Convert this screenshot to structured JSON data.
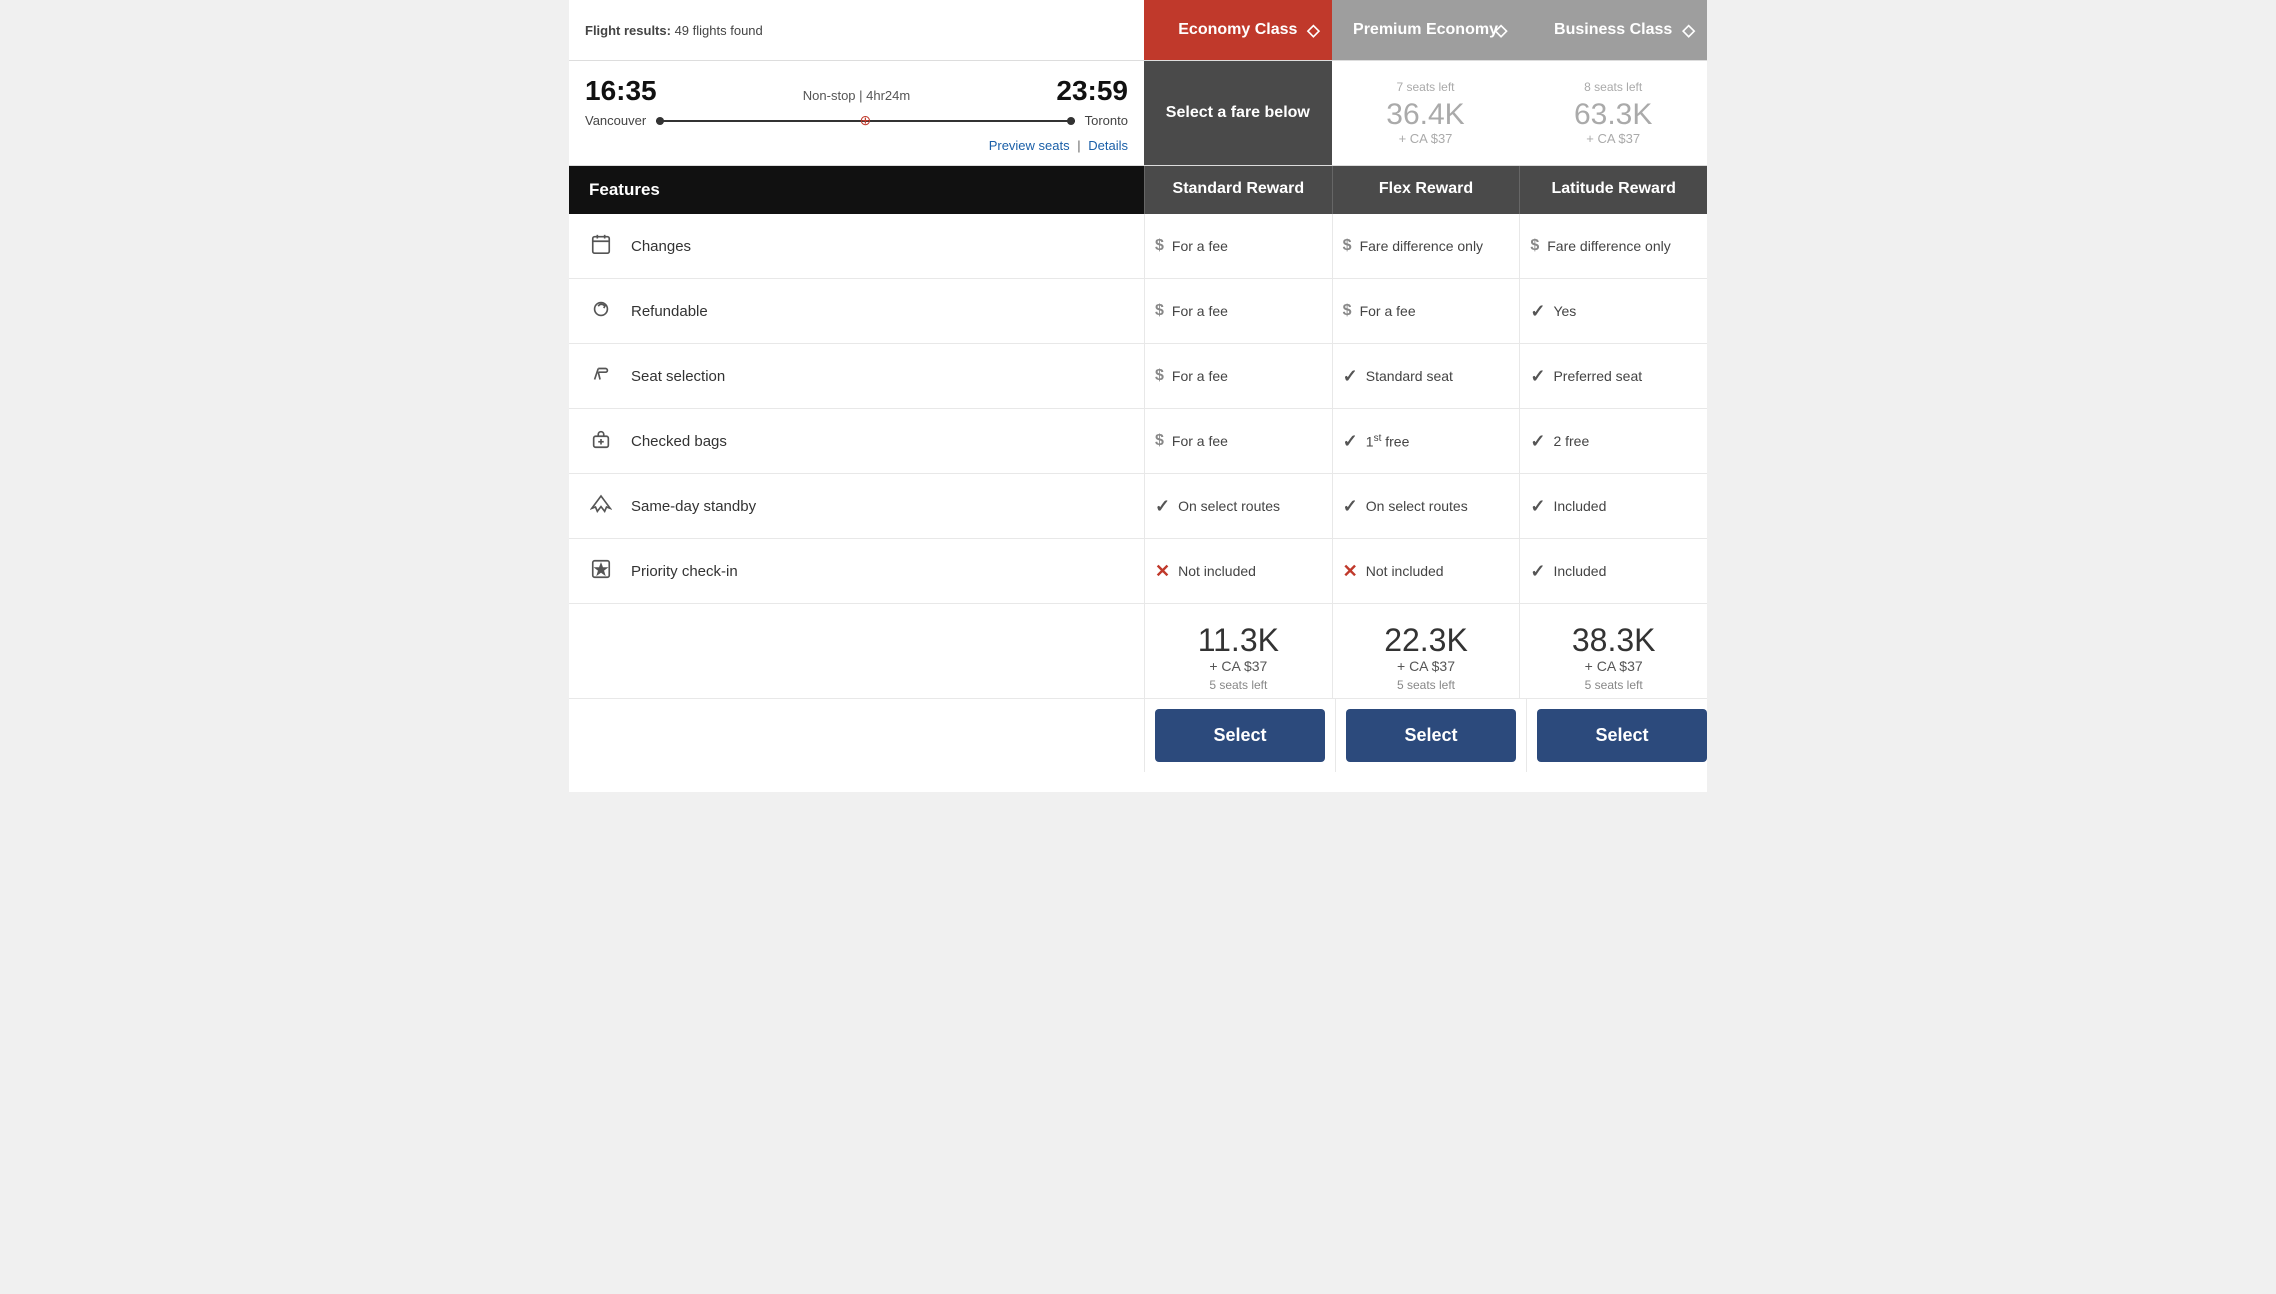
{
  "header": {
    "flight_results_label": "Flight results:",
    "flight_count": "49 flights found",
    "classes": [
      {
        "name": "Economy Class",
        "type": "economy",
        "arrow": "⬦"
      },
      {
        "name": "Premium Economy",
        "type": "premium",
        "arrow": "⬦"
      },
      {
        "name": "Business Class",
        "type": "business",
        "arrow": "⬦"
      }
    ]
  },
  "flight": {
    "depart_time": "16:35",
    "arrive_time": "23:59",
    "flight_desc": "Non-stop | 4hr24m",
    "origin": "Vancouver",
    "destination": "Toronto",
    "preview_seats": "Preview seats",
    "details": "Details"
  },
  "fare_tops": [
    {
      "type": "selected",
      "text": "Select a fare below"
    },
    {
      "type": "greyed",
      "seats_left": "7 seats left",
      "price_main": "36.4K",
      "price_sub": "+ CA $37"
    },
    {
      "type": "greyed",
      "seats_left": "8 seats left",
      "price_main": "63.3K",
      "price_sub": "+ CA $37"
    }
  ],
  "features_header": {
    "label": "Features",
    "fare_cols": [
      "Standard Reward",
      "Flex Reward",
      "Latitude Reward"
    ]
  },
  "features": [
    {
      "icon": "📅",
      "label": "Changes",
      "values": [
        {
          "icon": "$",
          "type": "dollar",
          "text": "For a fee"
        },
        {
          "icon": "$",
          "type": "dollar",
          "text": "Fare difference only"
        },
        {
          "icon": "$",
          "type": "dollar",
          "text": "Fare difference only"
        }
      ]
    },
    {
      "icon": "↺",
      "label": "Refundable",
      "values": [
        {
          "icon": "$",
          "type": "dollar",
          "text": "For a fee"
        },
        {
          "icon": "$",
          "type": "dollar",
          "text": "For a fee"
        },
        {
          "icon": "✓",
          "type": "check",
          "text": "Yes"
        }
      ]
    },
    {
      "icon": "⊾",
      "label": "Seat selection",
      "values": [
        {
          "icon": "$",
          "type": "dollar",
          "text": "For a fee"
        },
        {
          "icon": "✓",
          "type": "check",
          "text": "Standard seat"
        },
        {
          "icon": "✓",
          "type": "check",
          "text": "Preferred seat"
        }
      ]
    },
    {
      "icon": "🧳",
      "label": "Checked bags",
      "values": [
        {
          "icon": "$",
          "type": "dollar",
          "text": "For a fee"
        },
        {
          "icon": "✓",
          "type": "check",
          "text": "1st free",
          "sup": "st",
          "base": "1"
        },
        {
          "icon": "✓",
          "type": "check",
          "text": "2 free"
        }
      ]
    },
    {
      "icon": "✈",
      "label": "Same-day standby",
      "values": [
        {
          "icon": "✓",
          "type": "check",
          "text": "On select routes"
        },
        {
          "icon": "✓",
          "type": "check",
          "text": "On select routes"
        },
        {
          "icon": "✓",
          "type": "check",
          "text": "Included"
        }
      ]
    },
    {
      "icon": "★",
      "label": "Priority check-in",
      "values": [
        {
          "icon": "✗",
          "type": "cross",
          "text": "Not included"
        },
        {
          "icon": "✗",
          "type": "cross",
          "text": "Not included"
        },
        {
          "icon": "✓",
          "type": "check",
          "text": "Included"
        }
      ]
    }
  ],
  "pricing": [
    {
      "points": "11.3K",
      "plus_ca": "+ CA $37",
      "seats_left": "5 seats left"
    },
    {
      "points": "22.3K",
      "plus_ca": "+ CA $37",
      "seats_left": "5 seats left"
    },
    {
      "points": "38.3K",
      "plus_ca": "+ CA $37",
      "seats_left": "5 seats left"
    }
  ],
  "select_buttons": [
    "Select",
    "Select",
    "Select"
  ]
}
